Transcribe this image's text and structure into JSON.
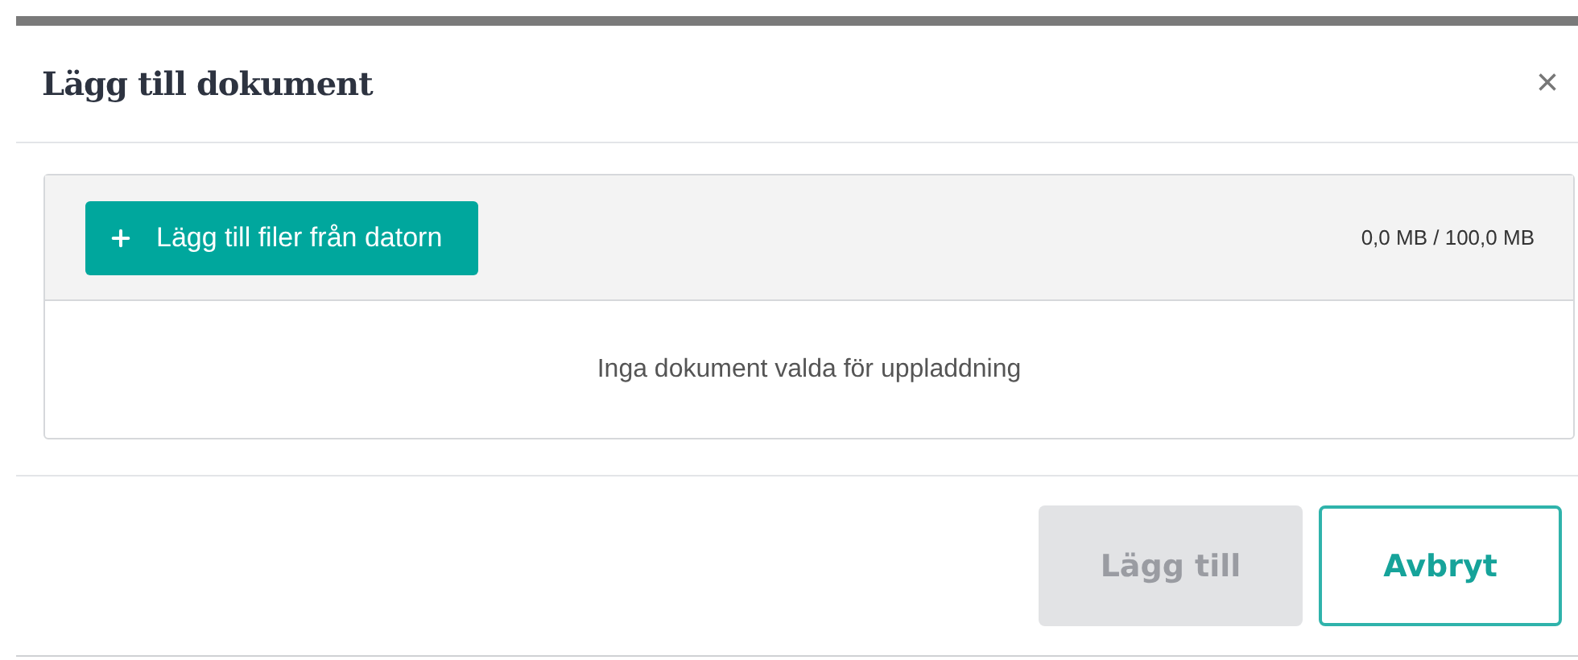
{
  "dialog": {
    "title": "Lägg till dokument",
    "close_label": "×"
  },
  "upload": {
    "add_button": "Lägg till filer från datorn",
    "quota": "0,0 MB / 100,0 MB",
    "empty_message": "Inga dokument valda för uppladdning"
  },
  "buttons": [
    {
      "label": "Lägg till",
      "disabled": true,
      "kind": "primary"
    },
    {
      "label": "Avbryt",
      "disabled": false,
      "kind": "outline"
    }
  ]
}
